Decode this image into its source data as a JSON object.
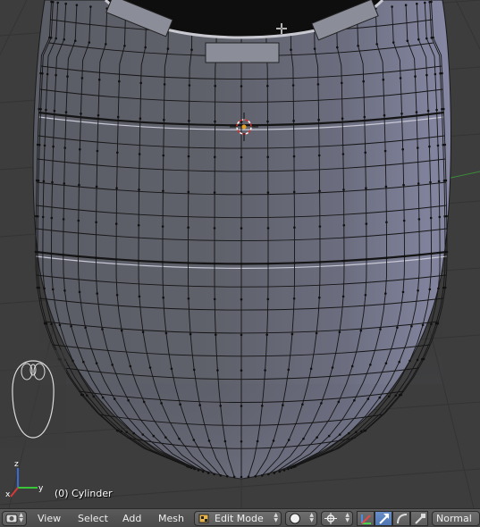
{
  "viewport": {
    "object_label": "(0) Cylinder"
  },
  "header": {
    "editor_type_icon": "3d-view-editor-icon",
    "menus": [
      "View",
      "Select",
      "Add",
      "Mesh"
    ],
    "mode": {
      "icon": "edit-mode-icon",
      "label": "Edit Mode"
    },
    "viewport_shading_icon": "solid-sphere-icon",
    "pivot_icon": "pivot-point-icon",
    "manipulator_icons": [
      "manipulator-toggle-icon",
      "translate-arrow-icon",
      "rotate-arc-icon",
      "scale-icon"
    ],
    "transform_orientation": "Normal"
  },
  "colors": {
    "viewport_bg": "#3d3d3d",
    "grid_line": "#333333",
    "mesh_face": "#6f7180",
    "mesh_edge": "#000000",
    "axis_x": "#d43a3a",
    "axis_y": "#3ac43a",
    "axis_z": "#3a6ad4",
    "header_bg": "#4f4f4f",
    "active_button": "#5680c2"
  }
}
